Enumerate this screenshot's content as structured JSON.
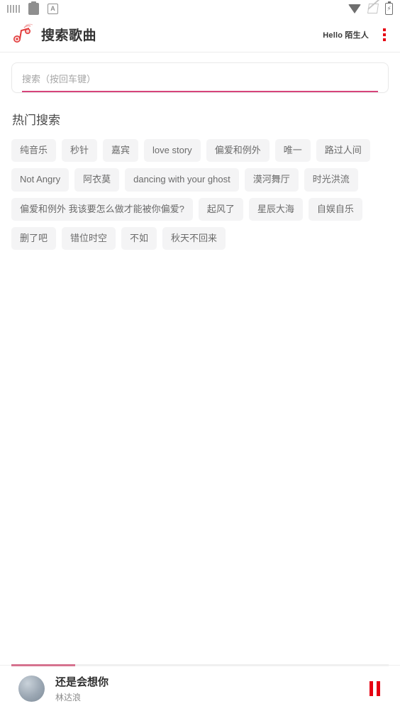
{
  "status_bar": {
    "left_icons": [
      "keyboard-icon",
      "clipboard-icon",
      "abc-input-icon"
    ],
    "abc_label": "A",
    "right_icons": [
      "wifi-icon",
      "signal-off-icon",
      "battery-charging-icon"
    ],
    "battery_glyph": "⚡"
  },
  "header": {
    "logo_icon": "music-note-logo",
    "title": "搜索歌曲",
    "greeting": "Hello 陌生人",
    "menu_icon": "kebab-menu-icon",
    "accent_color": "#e60012"
  },
  "search": {
    "placeholder": "搜索（按回车键）",
    "value": "",
    "underline_color": "#d6447a"
  },
  "hot_search": {
    "title": "热门搜索",
    "tags": [
      "纯音乐",
      "秒针",
      "嘉宾",
      "love story",
      "偏爱和例外",
      "唯一",
      "路过人间",
      "Not Angry",
      "阿衣莫",
      "dancing with your ghost",
      "漠河舞厅",
      "时光洪流",
      "偏爱和例外 我该要怎么做才能被你偏爱?",
      "起风了",
      "星辰大海",
      "自娱自乐",
      "删了吧",
      "错位时空",
      "不如",
      "秋天不回来"
    ]
  },
  "player": {
    "title": "还是会想你",
    "artist": "林达浪",
    "progress_percent": 17,
    "progress_color": "#d6738f",
    "control_icon": "pause-icon",
    "control_color": "#e60012",
    "album_art_icon": "album-art-thumbnail"
  }
}
